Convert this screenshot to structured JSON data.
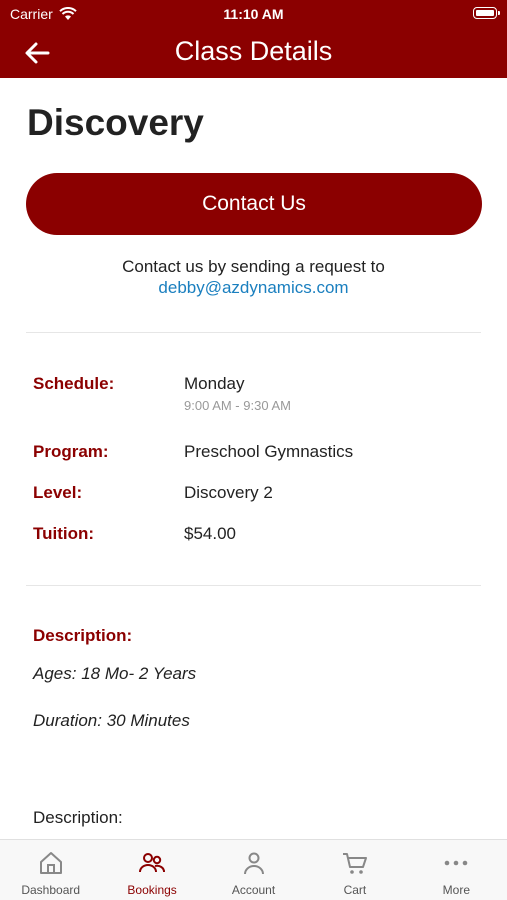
{
  "status_bar": {
    "carrier": "Carrier",
    "time": "11:10 AM"
  },
  "nav": {
    "title": "Class Details"
  },
  "class": {
    "name": "Discovery",
    "contact_button": "Contact Us",
    "contact_text": "Contact us by sending a request to",
    "contact_email": "debby@azdynamics.com"
  },
  "details": {
    "schedule_label": "Schedule:",
    "schedule_day": "Monday",
    "schedule_time": "9:00 AM - 9:30 AM",
    "program_label": "Program:",
    "program_value": "Preschool Gymnastics",
    "level_label": "Level:",
    "level_value": "Discovery 2",
    "tuition_label": "Tuition:",
    "tuition_value": "$54.00"
  },
  "description": {
    "label": "Description:",
    "ages": "Ages: 18 Mo- 2 Years",
    "duration": "Duration: 30 Minutes",
    "plain_label": "Description:"
  },
  "tabs": [
    {
      "label": "Dashboard",
      "icon": "home-icon",
      "active": false
    },
    {
      "label": "Bookings",
      "icon": "people-icon",
      "active": true
    },
    {
      "label": "Account",
      "icon": "person-icon",
      "active": false
    },
    {
      "label": "Cart",
      "icon": "cart-icon",
      "active": false
    },
    {
      "label": "More",
      "icon": "more-icon",
      "active": false
    }
  ],
  "colors": {
    "brand": "#8b0000",
    "link": "#1a7fbf",
    "tab_inactive": "#888888"
  }
}
